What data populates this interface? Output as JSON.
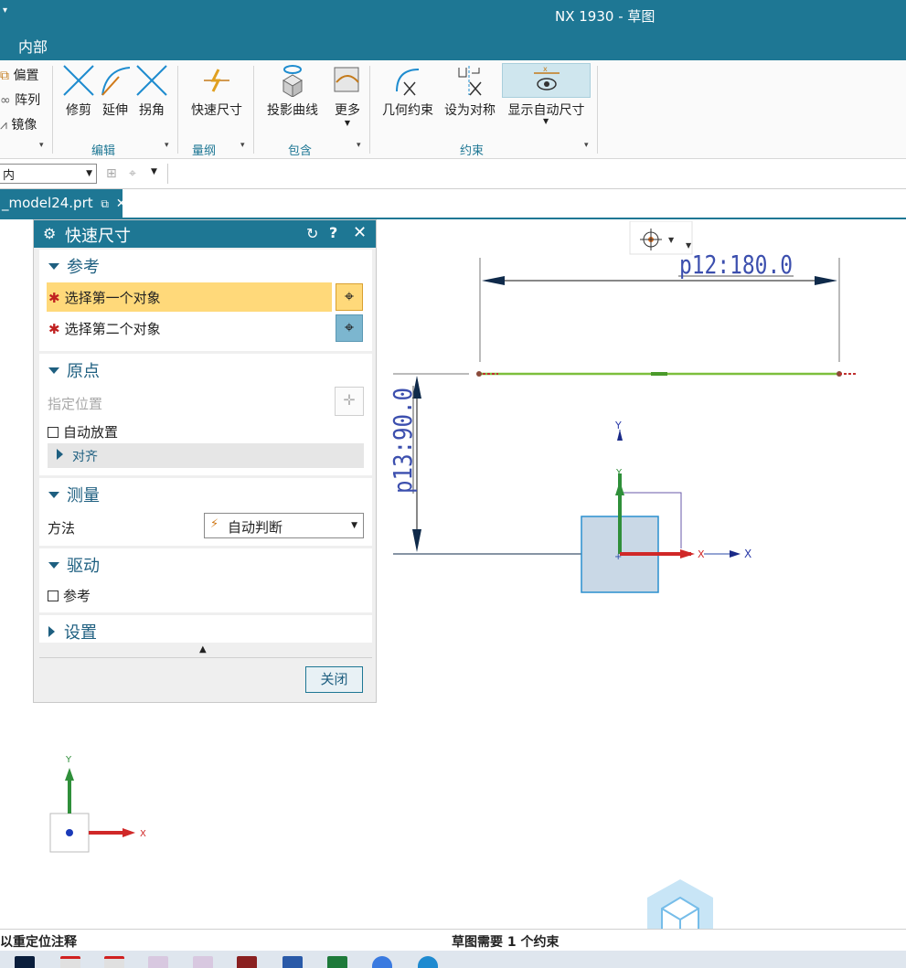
{
  "window": {
    "title": "NX 1930 - 草图",
    "sys_menu": "▾"
  },
  "ribbon_tab": "内部",
  "ribbon": {
    "small_items": [
      "偏置",
      "阵列",
      "镜像"
    ],
    "edit_buttons": [
      "修剪",
      "延伸",
      "拐角"
    ],
    "dimension_button": "快速尺寸",
    "include_buttons": [
      "投影曲线",
      "更多"
    ],
    "constraint_buttons": [
      "几何约束",
      "设为对称",
      "显示自动尺寸"
    ],
    "groups": [
      "编辑",
      "量纲",
      "包含",
      "约束"
    ]
  },
  "selection_bar": {
    "filter_value": "内"
  },
  "document_tab": {
    "label": "_model24.prt"
  },
  "dialog": {
    "title": "快速尺寸",
    "reference": {
      "title": "参考",
      "first": "选择第一个对象",
      "second": "选择第二个对象"
    },
    "origin": {
      "title": "原点",
      "specify": "指定位置",
      "auto_place": "自动放置",
      "align": "对齐"
    },
    "measure": {
      "title": "测量",
      "method_label": "方法",
      "method_value": "自动判断"
    },
    "drive": {
      "title": "驱动",
      "reference": "参考"
    },
    "settings": {
      "title": "设置"
    },
    "close_label": "关闭"
  },
  "canvas": {
    "dim_horizontal": "p12:180.0",
    "dim_vertical": "p13:90.0",
    "axis_x": "X",
    "axis_y": "Y"
  },
  "status": {
    "left": "以重定位注释",
    "center": "草图需要 1 个约束"
  },
  "colors": {
    "accent": "#1e7794",
    "highlight": "#ffd97a",
    "sketch_line": "#7cbf3c",
    "axis_x": "#d02828",
    "axis_y": "#2f8f3a"
  }
}
